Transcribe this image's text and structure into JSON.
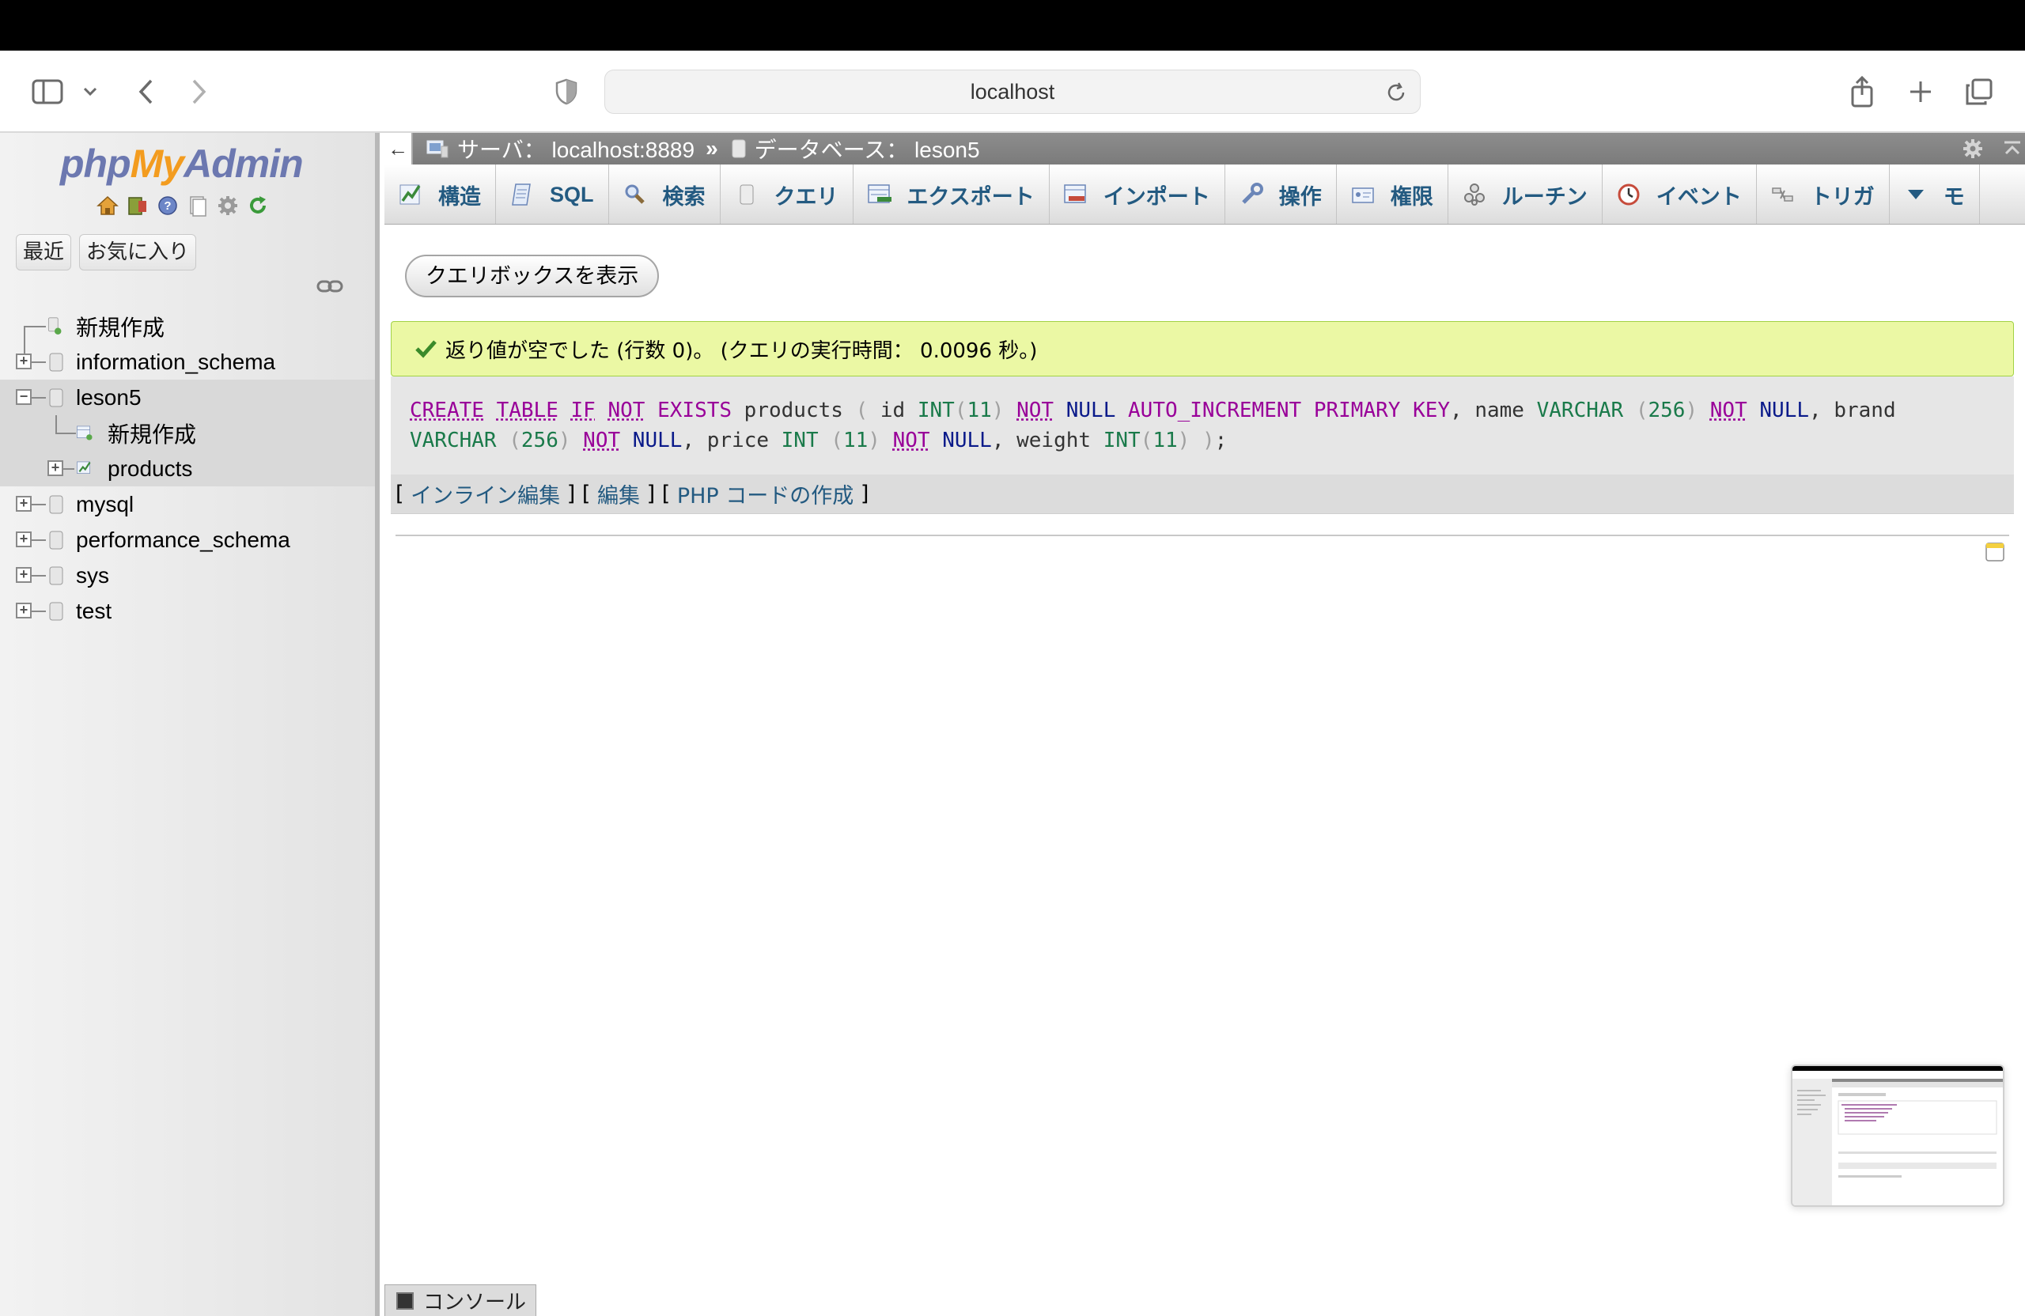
{
  "browser": {
    "url": "localhost"
  },
  "nav": {
    "logo": {
      "php": "php",
      "my": "My",
      "admin": "Admin"
    },
    "tabs": {
      "recent": "最近",
      "favorites": "お気に入り"
    },
    "tree": [
      {
        "label": "新規作成",
        "type": "new"
      },
      {
        "label": "information_schema",
        "type": "db"
      },
      {
        "label": "leson5",
        "type": "db",
        "expanded": true
      },
      {
        "label": "新規作成",
        "type": "new-child"
      },
      {
        "label": "products",
        "type": "table"
      },
      {
        "label": "mysql",
        "type": "db"
      },
      {
        "label": "performance_schema",
        "type": "db"
      },
      {
        "label": "sys",
        "type": "db"
      },
      {
        "label": "test",
        "type": "db"
      }
    ]
  },
  "breadcrumb": {
    "server": "サーバ： localhost:8889",
    "separator": "»",
    "database": "データベース： leson5"
  },
  "menu": {
    "items": [
      {
        "label": "構造",
        "icon": "structure-icon"
      },
      {
        "label": "SQL",
        "icon": "sql-icon"
      },
      {
        "label": "検索",
        "icon": "search-icon"
      },
      {
        "label": "クエリ",
        "icon": "query-icon"
      },
      {
        "label": "エクスポート",
        "icon": "export-icon"
      },
      {
        "label": "インポート",
        "icon": "import-icon"
      },
      {
        "label": "操作",
        "icon": "wrench-icon"
      },
      {
        "label": "権限",
        "icon": "privileges-icon"
      },
      {
        "label": "ルーチン",
        "icon": "routines-icon"
      },
      {
        "label": "イベント",
        "icon": "events-icon"
      },
      {
        "label": "トリガ",
        "icon": "triggers-icon"
      },
      {
        "label": "モ",
        "icon": "more-icon"
      }
    ]
  },
  "main": {
    "show_query_button": "クエリボックスを表示",
    "success_message": "返り値が空でした (行数 0)。 (クエリの実行時間： 0.0096 秒。)",
    "sql_links": {
      "open": "[",
      "inline_edit": "インライン編集",
      "mid1": "] [",
      "edit": "編集",
      "mid2": "] [",
      "php_code": "PHP コードの作成",
      "close": "]"
    },
    "console_label": "コンソール"
  },
  "sql": {
    "line1": [
      [
        "kwu",
        "CREATE"
      ],
      [
        "sp",
        " "
      ],
      [
        "kwu",
        "TABLE"
      ],
      [
        "sp",
        " "
      ],
      [
        "kwu",
        "IF"
      ],
      [
        "sp",
        " "
      ],
      [
        "kwu",
        "NOT"
      ],
      [
        "sp",
        " "
      ],
      [
        "kw",
        "EXISTS"
      ],
      [
        "plain",
        " products "
      ],
      [
        "pun",
        "("
      ],
      [
        "plain",
        " id "
      ],
      [
        "typ",
        "INT"
      ],
      [
        "pun",
        "("
      ],
      [
        "num",
        "11"
      ],
      [
        "pun",
        ")"
      ],
      [
        "sp",
        " "
      ],
      [
        "kwu",
        "NOT"
      ],
      [
        "sp",
        " "
      ],
      [
        "nul",
        "NULL"
      ],
      [
        "sp",
        " "
      ],
      [
        "kw",
        "AUTO_INCREMENT"
      ],
      [
        "sp",
        " "
      ],
      [
        "kw",
        "PRIMARY"
      ],
      [
        "sp",
        " "
      ],
      [
        "kw",
        "KEY"
      ],
      [
        "plain",
        ", name "
      ],
      [
        "typ",
        "VARCHAR"
      ],
      [
        "sp",
        " "
      ],
      [
        "pun",
        "("
      ],
      [
        "num",
        "256"
      ],
      [
        "pun",
        ")"
      ],
      [
        "sp",
        " "
      ],
      [
        "kwu",
        "NOT"
      ],
      [
        "sp",
        " "
      ],
      [
        "nul",
        "NULL"
      ],
      [
        "plain",
        ", brand"
      ]
    ],
    "line2": [
      [
        "typ",
        "VARCHAR"
      ],
      [
        "sp",
        " "
      ],
      [
        "pun",
        "("
      ],
      [
        "num",
        "256"
      ],
      [
        "pun",
        ")"
      ],
      [
        "sp",
        " "
      ],
      [
        "kwu",
        "NOT"
      ],
      [
        "sp",
        " "
      ],
      [
        "nul",
        "NULL"
      ],
      [
        "plain",
        ", price "
      ],
      [
        "typ",
        "INT"
      ],
      [
        "sp",
        " "
      ],
      [
        "pun",
        "("
      ],
      [
        "num",
        "11"
      ],
      [
        "pun",
        ")"
      ],
      [
        "sp",
        " "
      ],
      [
        "kwu",
        "NOT"
      ],
      [
        "sp",
        " "
      ],
      [
        "nul",
        "NULL"
      ],
      [
        "plain",
        ", weight "
      ],
      [
        "typ",
        "INT"
      ],
      [
        "pun",
        "("
      ],
      [
        "num",
        "11"
      ],
      [
        "pun",
        ")"
      ],
      [
        "sp",
        " "
      ],
      [
        "pun",
        ")"
      ],
      [
        "plain",
        ";"
      ]
    ]
  },
  "colors": {
    "accent_link": "#235a81",
    "success_bg": "#ebf8a4",
    "keyword": "#990099",
    "type": "#1a7a4a",
    "null": "#0a1a8a"
  }
}
